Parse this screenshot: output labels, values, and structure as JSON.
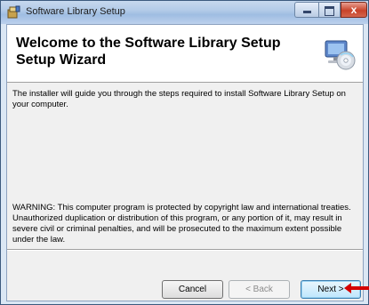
{
  "window": {
    "title": "Software Library Setup",
    "controls": {
      "minimize_icon": "minimize-icon",
      "maximize_icon": "maximize-icon",
      "close_glyph": "x"
    }
  },
  "banner": {
    "title": "Welcome to the Software Library Setup Setup Wizard",
    "icon": "setup-disc-computer-icon"
  },
  "body": {
    "intro": "The installer will guide you through the steps required to install Software Library Setup on your computer.",
    "warning": "WARNING: This computer program is protected by copyright law and international treaties. Unauthorized duplication or distribution of this program, or any portion of it, may result in severe civil or criminal penalties, and will be prosecuted to the maximum extent possible under the law."
  },
  "buttons": {
    "cancel": "Cancel",
    "back": "< Back",
    "next": "Next >"
  },
  "annotation": {
    "arrow_color": "#d40000"
  }
}
